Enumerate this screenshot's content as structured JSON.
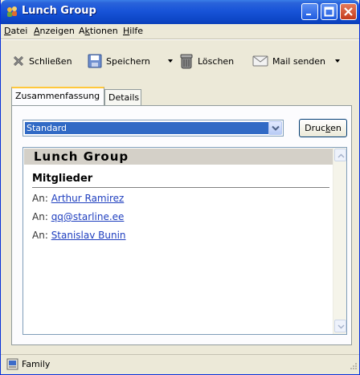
{
  "window": {
    "title": "Lunch Group",
    "controls": {
      "minimize": "minimize-icon",
      "maximize": "maximize-icon",
      "close": "close-icon"
    }
  },
  "menu": {
    "items": [
      {
        "label": "Datei",
        "mnemonic": "D"
      },
      {
        "label": "Anzeigen",
        "mnemonic": "A"
      },
      {
        "label": "Aktionen",
        "mnemonic": "k"
      },
      {
        "label": "Hilfe",
        "mnemonic": "H"
      }
    ]
  },
  "toolbar": {
    "close_label": "Schließen",
    "save_label": "Speichern",
    "delete_label": "Löschen",
    "mail_label": "Mail senden"
  },
  "tabs": [
    {
      "label": "Zusammenfassung",
      "active": true
    },
    {
      "label": "Details",
      "active": false
    }
  ],
  "summary": {
    "layout_select": {
      "value": "Standard"
    },
    "print_label": "Drucken",
    "banner_title": "Lunch Group",
    "section_title": "Mitglieder",
    "prefix": "An:",
    "members": [
      "Arthur Ramirez",
      "qq@starline.ee",
      "Stanislav Bunin"
    ]
  },
  "status": {
    "folder": "Family"
  },
  "colors": {
    "titlebar": "#0a3fb9",
    "selection": "#316ac5",
    "link": "#1f3fbf",
    "active_tab_accent": "#ffc83c"
  }
}
